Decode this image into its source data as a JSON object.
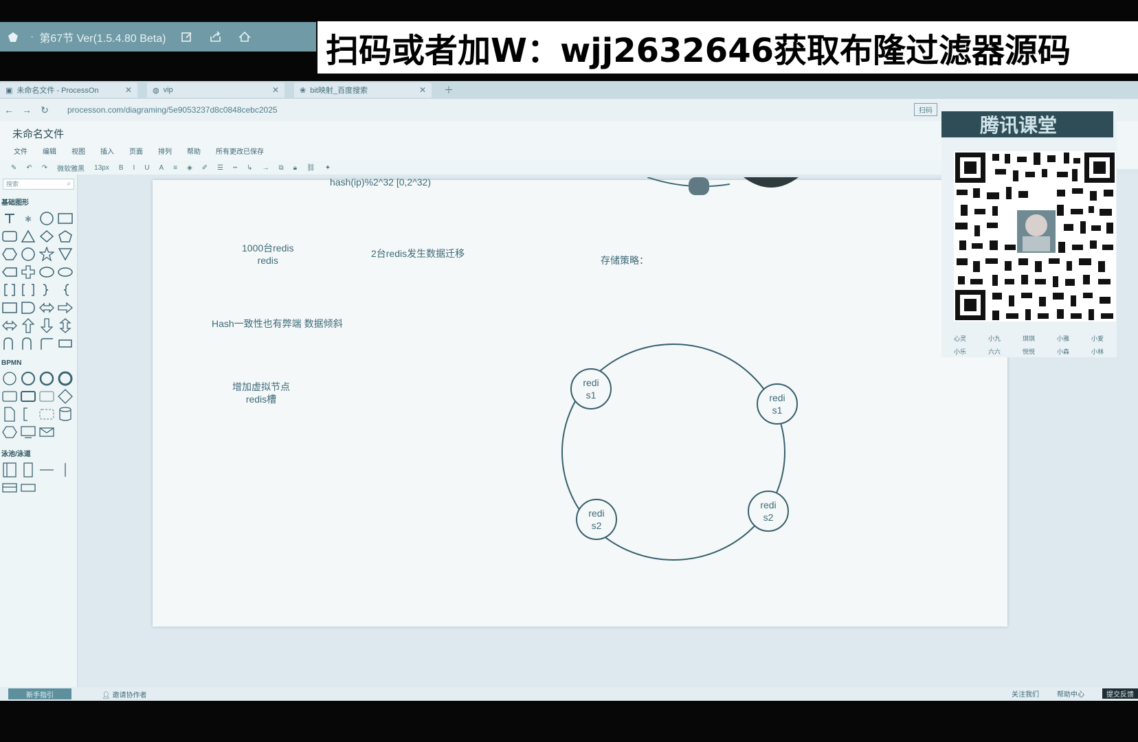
{
  "player": {
    "title": "第67节 Ver(1.5.4.80 Beta)",
    "separator": "·"
  },
  "banner": {
    "text": "扫码或者加W：wjj2632646获取布隆过滤器源码"
  },
  "browser": {
    "tabs": [
      {
        "label": "未命名文件 - ProcessOn"
      },
      {
        "label": "vip"
      },
      {
        "label": "bit映射_百度搜索"
      }
    ],
    "url": "processon.com/diagraming/5e9053237d8c0848cebc2025",
    "scan_button": "扫码"
  },
  "app": {
    "doc_title": "未命名文件",
    "menu": [
      "文件",
      "编辑",
      "视图",
      "插入",
      "页面",
      "排列",
      "帮助",
      "所有更改已保存"
    ],
    "toolbar": [
      "微软雅黑",
      "13px",
      "B",
      "I",
      "U",
      "A"
    ]
  },
  "palette": {
    "search_placeholder": "搜索",
    "sections": [
      "基础图形",
      "BPMN",
      "泳池/泳道"
    ]
  },
  "canvas": {
    "top_formula": "hash(ip)%2^32 [0,2^32)",
    "notes": {
      "n1_line1": "1000台redis",
      "n1_line2": "redis",
      "n2": "2台redis发生数据迁移",
      "n3": "存储策略：",
      "n4": "Hash一致性也有弊端  数据倾斜",
      "n5_line1": "增加虚拟节点",
      "n5_line2": "redis槽"
    },
    "nodes": [
      {
        "line1": "redi",
        "line2": "s1"
      },
      {
        "line1": "redi",
        "line2": "s1"
      },
      {
        "line1": "redi",
        "line2": "s2"
      },
      {
        "line1": "redi",
        "line2": "s2"
      }
    ]
  },
  "side": {
    "brand": "腾讯课堂",
    "names": [
      "心灵",
      "小九",
      "琪琪",
      "小雅",
      "小爱",
      "小乐",
      "六六",
      "悦悦",
      "小森",
      "小林"
    ]
  },
  "status": {
    "left": "新手指引",
    "invite": "邀请协作者",
    "follow": "关注我们",
    "help": "帮助中心",
    "feedback": "提交反馈"
  }
}
